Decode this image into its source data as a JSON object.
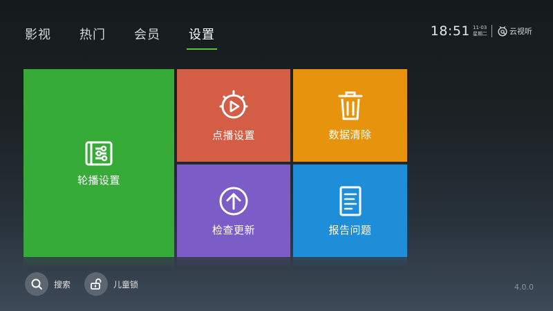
{
  "nav": {
    "items": [
      {
        "label": "影视"
      },
      {
        "label": "热门"
      },
      {
        "label": "会员"
      },
      {
        "label": "设置"
      }
    ],
    "active_index": 3
  },
  "status": {
    "time": "18:51",
    "date": "11-03",
    "weekday": "星期二",
    "brand": "云视听"
  },
  "tiles": {
    "carousel": {
      "label": "轮播设置",
      "icon": "list-settings-icon",
      "color": "#36ab38"
    },
    "vod": {
      "label": "点播设置",
      "icon": "play-dial-icon",
      "color": "#d35d45"
    },
    "clear": {
      "label": "数据清除",
      "icon": "trash-icon",
      "color": "#e8930d"
    },
    "update": {
      "label": "检查更新",
      "icon": "arrow-up-circle-icon",
      "color": "#7c5dc8"
    },
    "report": {
      "label": "报告问题",
      "icon": "document-icon",
      "color": "#1f8ed8"
    }
  },
  "bottom": {
    "search": {
      "label": "搜索",
      "icon": "search-icon"
    },
    "child_lock": {
      "label": "儿童锁",
      "icon": "unlock-icon"
    }
  },
  "version": "4.0.0",
  "accent_color": "#58c43f"
}
